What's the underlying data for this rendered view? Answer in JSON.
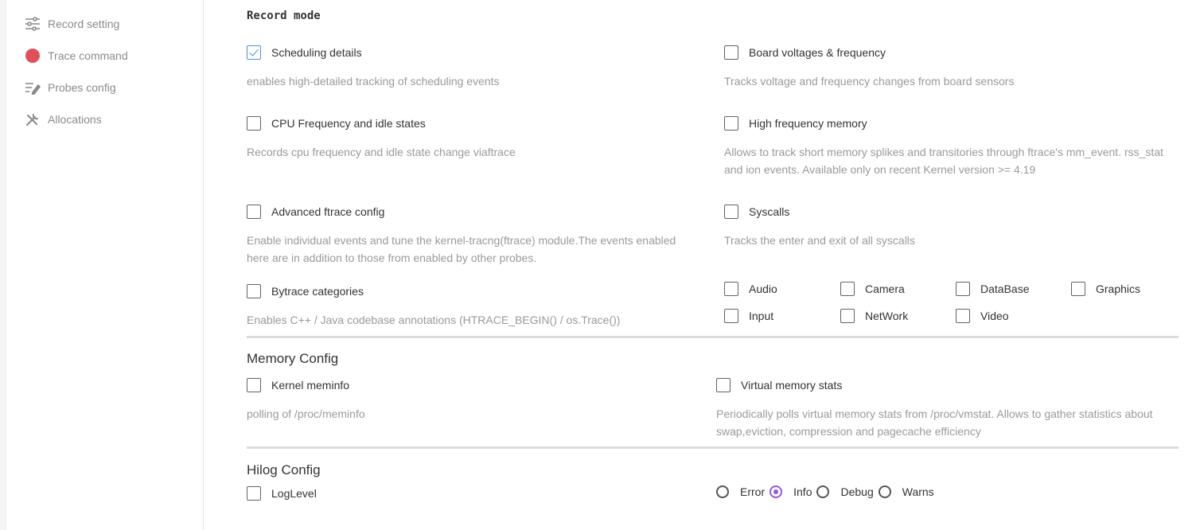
{
  "sidebar": {
    "items": [
      {
        "label": "Record setting",
        "icon": "sliders-icon"
      },
      {
        "label": "Trace command",
        "icon": "red-circle-icon"
      },
      {
        "label": "Probes config",
        "icon": "edit-list-icon"
      },
      {
        "label": "Allocations",
        "icon": "tools-icon"
      }
    ]
  },
  "record_mode": {
    "title": "Record mode",
    "options": [
      {
        "label": "Scheduling details",
        "checked": true,
        "desc": "enables high-detailed tracking of scheduling events"
      },
      {
        "label": "Board voltages & frequency",
        "checked": false,
        "desc": "Tracks voltage and frequency changes from board sensors"
      },
      {
        "label": "CPU Frequency and idle states",
        "checked": false,
        "desc": "Records cpu frequency and idle state change viaftrace"
      },
      {
        "label": "High frequency memory",
        "checked": false,
        "desc": "Allows to track short memory splikes and transitories through ftrace's mm_event. rss_stat and ion events. Available only on recent Kernel version >= 4.19"
      },
      {
        "label": "Advanced ftrace config",
        "checked": false,
        "desc": "Enable individual events and tune the kernel-tracng(ftrace) module.The events enabled here are in addition to those from enabled by other probes."
      },
      {
        "label": "Syscalls",
        "checked": false,
        "desc": "Tracks the enter and exit of all syscalls"
      },
      {
        "label": "Bytrace categories",
        "checked": false,
        "desc": "Enables C++ / Java codebase annotations (HTRACE_BEGIN() / os.Trace())"
      }
    ],
    "categories": [
      {
        "label": "Audio",
        "checked": false
      },
      {
        "label": "Camera",
        "checked": false
      },
      {
        "label": "DataBase",
        "checked": false
      },
      {
        "label": "Graphics",
        "checked": false
      },
      {
        "label": "Input",
        "checked": false
      },
      {
        "label": "NetWork",
        "checked": false
      },
      {
        "label": "Video",
        "checked": false
      }
    ]
  },
  "memory_config": {
    "title": "Memory Config",
    "options": [
      {
        "label": "Kernel meminfo",
        "checked": false,
        "desc": "polling of /proc/meminfo"
      },
      {
        "label": "Virtual memory stats",
        "checked": false,
        "desc": "Periodically polls virtual memory stats from /proc/vmstat. Allows to gather statistics about swap,eviction, compression and pagecache efficiency"
      }
    ]
  },
  "hilog_config": {
    "title": "Hilog Config",
    "loglevel_label": "LogLevel",
    "loglevel_checked": false,
    "levels": [
      {
        "label": "Error",
        "selected": false
      },
      {
        "label": "Info",
        "selected": true
      },
      {
        "label": "Debug",
        "selected": false
      },
      {
        "label": "Warns",
        "selected": false
      }
    ]
  },
  "colors": {
    "accent_blue": "#4a90e2",
    "radio_purple": "#9158d6",
    "trace_red": "#e0505a"
  }
}
